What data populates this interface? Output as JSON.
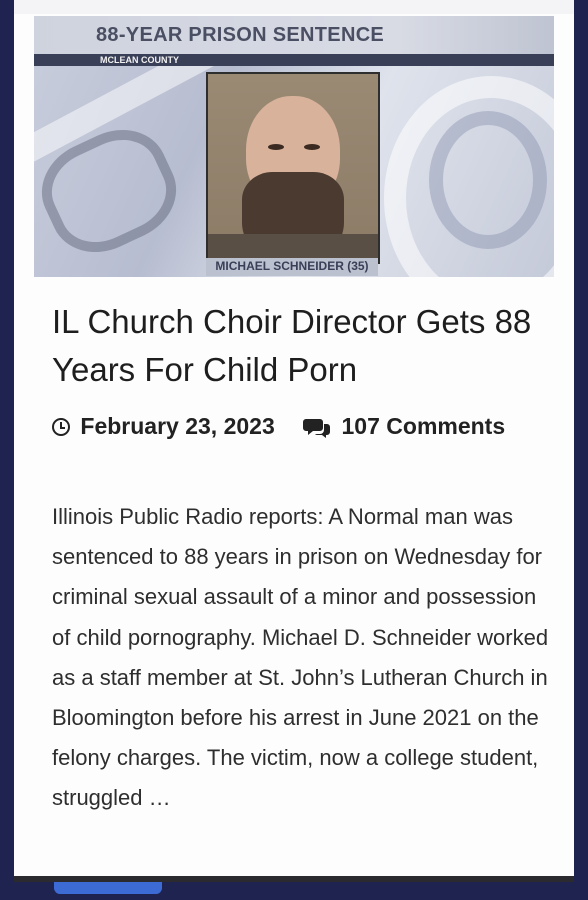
{
  "news_image": {
    "banner_title": "88-YEAR PRISON SENTENCE",
    "banner_subtitle": "MCLEAN COUNTY",
    "caption": "MICHAEL SCHNEIDER (35)"
  },
  "article": {
    "headline": "IL Church Choir Director Gets 88 Years For Child Porn",
    "date": "February 23, 2023",
    "comments": "107 Comments",
    "excerpt": "Illinois Public Radio reports: A Normal man was sentenced to 88 years in prison on Wednesday for criminal sexual assault of a minor and possession of child pornography. Michael D. Schneider worked as a staff member at St. John’s Lutheran Church in Bloomington before his arrest in June 2021 on the felony charges. The victim, now a college student, struggled …"
  },
  "icons": {
    "date": "clock-icon",
    "comments": "comments-icon"
  },
  "colors": {
    "frame": "#1f2350",
    "button": "#3d6bd6"
  }
}
